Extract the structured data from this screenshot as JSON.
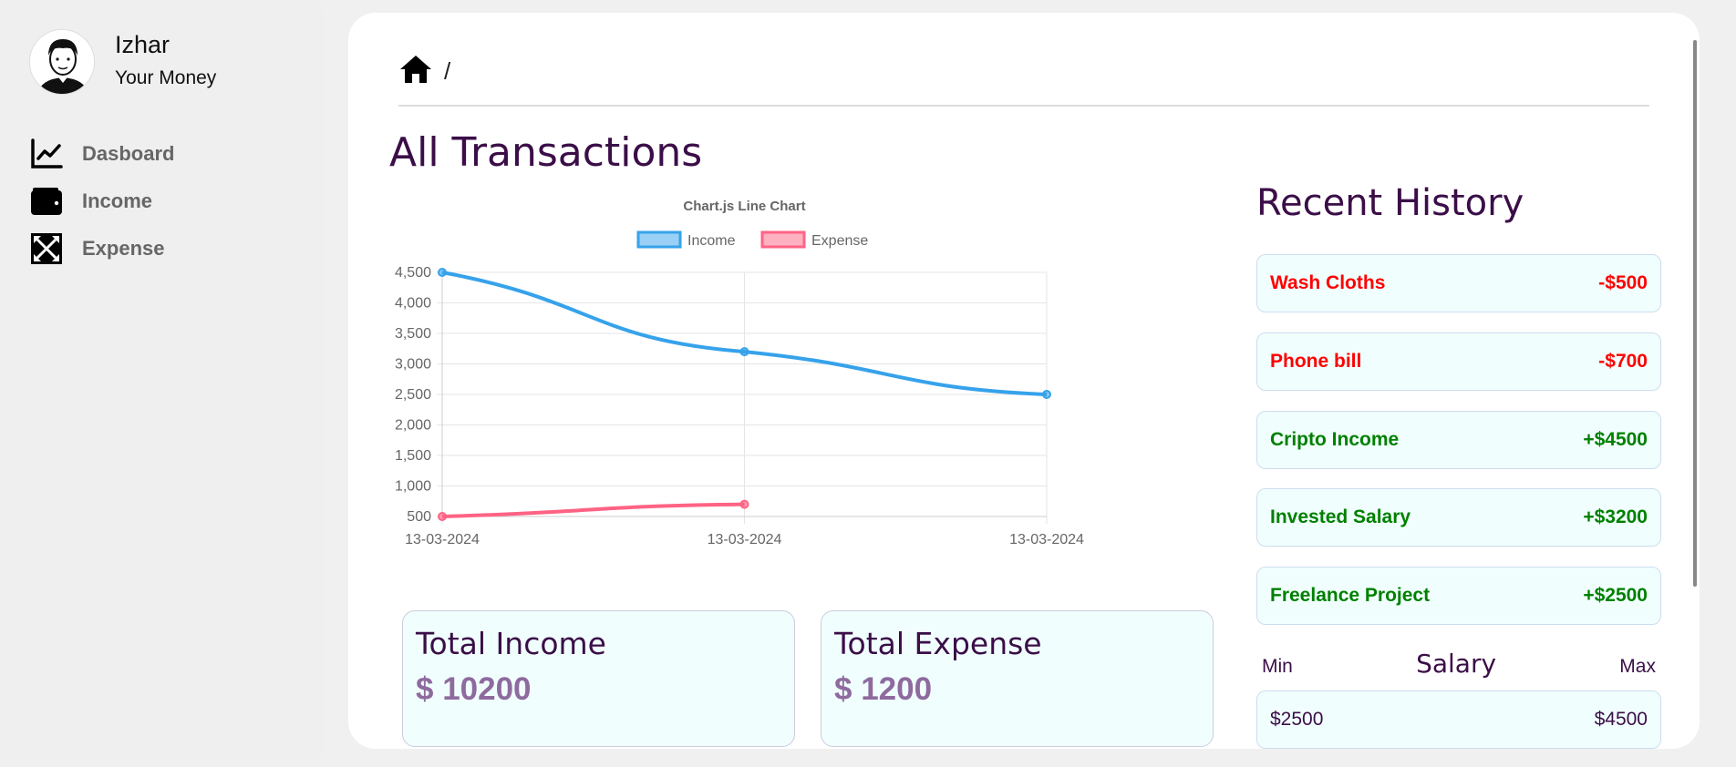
{
  "user": {
    "name": "Izhar",
    "subtitle": "Your Money"
  },
  "nav": [
    {
      "label": "Dasboard",
      "icon": "chart-line-icon"
    },
    {
      "label": "Income",
      "icon": "wallet-icon"
    },
    {
      "label": "Expense",
      "icon": "expand-arrows-icon"
    }
  ],
  "breadcrumb": {
    "separator": "/"
  },
  "page": {
    "title": "All Transactions"
  },
  "chart_data": {
    "type": "line",
    "title": "Chart.js Line Chart",
    "categories": [
      "13-03-2024",
      "13-03-2024",
      "13-03-2024"
    ],
    "series": [
      {
        "name": "Income",
        "values": [
          4500,
          3200,
          2500
        ],
        "color": "#36a2eb"
      },
      {
        "name": "Expense",
        "values": [
          500,
          700,
          null
        ],
        "color": "#ff6384"
      }
    ],
    "ylim": [
      500,
      4500
    ],
    "yticks": [
      "4,500",
      "4,000",
      "3,500",
      "3,000",
      "2,500",
      "2,000",
      "1,500",
      "1,000",
      "500"
    ],
    "legend": "top",
    "grid": true
  },
  "totals": {
    "income_label": "Total Income",
    "income_value": "$ 10200",
    "expense_label": "Total Expense",
    "expense_value": "$ 1200"
  },
  "recent": {
    "title": "Recent History",
    "items": [
      {
        "name": "Wash Cloths",
        "amount": "-$500",
        "color": "#ff0000"
      },
      {
        "name": "Phone bill",
        "amount": "-$700",
        "color": "#ff0000"
      },
      {
        "name": "Cripto Income",
        "amount": "+$4500",
        "color": "#008000"
      },
      {
        "name": "Invested Salary",
        "amount": "+$3200",
        "color": "#008000"
      },
      {
        "name": "Freelance Project",
        "amount": "+$2500",
        "color": "#008000"
      }
    ]
  },
  "salary": {
    "title": "Salary",
    "min_label": "Min",
    "max_label": "Max",
    "min_value": "$2500",
    "max_value": "$4500"
  }
}
